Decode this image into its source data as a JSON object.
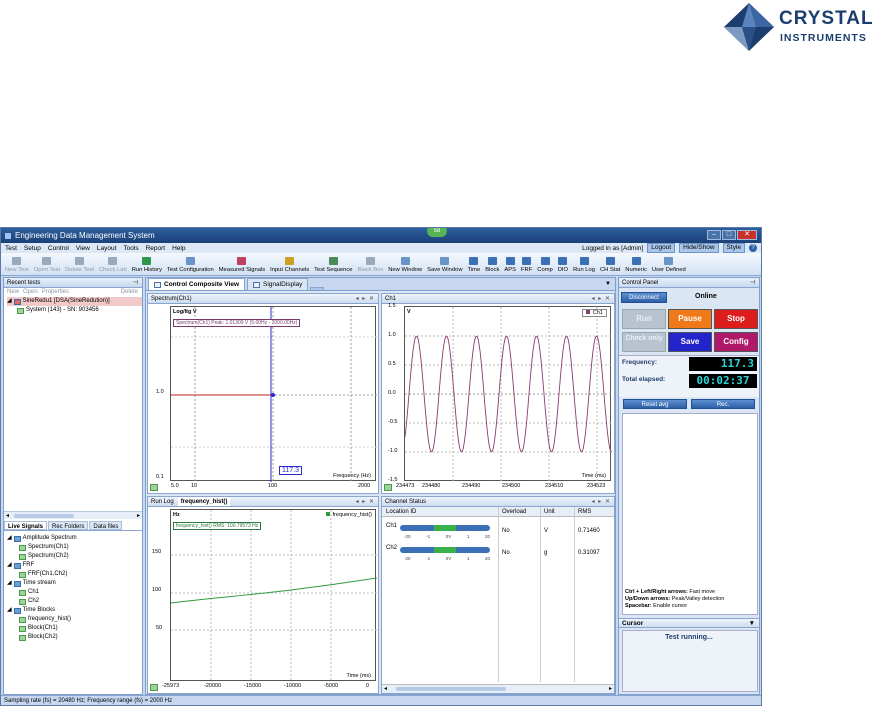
{
  "logo": {
    "line1": "CRYSTAL",
    "line2": "INSTRUMENTS"
  },
  "window": {
    "title": "Engineering Data Management System",
    "badge": "58"
  },
  "menu": {
    "items": [
      "Test",
      "Setup",
      "Control",
      "View",
      "Layout",
      "Tools",
      "Report",
      "Help"
    ],
    "logged_in": "Logged in as [Admin]",
    "logout": "Logout",
    "hide_show": "Hide/Show",
    "style": "Style",
    "help_icon": "?"
  },
  "toolbar": {
    "items": [
      "New Test",
      "Open Test",
      "Delete Test",
      "Check Lab",
      "Run History",
      "Test Configuration",
      "Measured Signals",
      "Input Channels",
      "Test Sequence",
      "Black Box",
      "New Window",
      "Save Window",
      "Time",
      "Block",
      "APS",
      "FRF",
      "Comp",
      "DIO",
      "Run Log",
      "CH Stat",
      "Numeric",
      "User Defined"
    ]
  },
  "recent_tests": {
    "header": "Recent tests",
    "actions": [
      "New",
      "Open",
      "Properties"
    ],
    "delete": "Delete",
    "items": [
      "SineRedu1  [DSA(SineRedution)]",
      "System (143) - SN: 903456"
    ]
  },
  "left_tabs": [
    "Live Signals",
    "Rec Folders",
    "Data files"
  ],
  "signal_tree": [
    {
      "label": "Amplitude Spectrum",
      "level": 0
    },
    {
      "label": "Spectrum(Ch1)",
      "level": 1
    },
    {
      "label": "Spectrum(Ch2)",
      "level": 1
    },
    {
      "label": "FRF",
      "level": 0
    },
    {
      "label": "FRF(Ch1,Ch2)",
      "level": 1
    },
    {
      "label": "Time stream",
      "level": 0
    },
    {
      "label": "Ch1",
      "level": 1
    },
    {
      "label": "Ch2",
      "level": 1
    },
    {
      "label": "Time Blocks",
      "level": 0
    },
    {
      "label": "frequency_hist()",
      "level": 1
    },
    {
      "label": "Block(Ch1)",
      "level": 1
    },
    {
      "label": "Block(Ch2)",
      "level": 1
    }
  ],
  "doc_tabs": [
    "Control Composite View",
    "SignalDisplay"
  ],
  "win_controls": "◂ ▸ ✕",
  "spectrum": {
    "tab": "Spectrum(Ch1)",
    "ylabel": "Log/Itg V",
    "annotation": "Spectrum(Ch1) Peak: 1.01309 V (5.00Hz - 2000.00Hz)",
    "yticks": [
      "1.0",
      "0.1"
    ],
    "xticks": [
      "5.0",
      "10",
      "100",
      "2000"
    ],
    "xlabel": "Frequency (Hz)",
    "cursor_value": "117.3"
  },
  "ch1": {
    "tab": "Ch1",
    "ylabel": "V",
    "legend": "Ch1",
    "yticks": [
      "1.5",
      "1.0",
      "0.5",
      "0.0",
      "-0.5",
      "-1.0",
      "-1.5"
    ],
    "xticks": [
      "234473",
      "234480",
      "234490",
      "234500",
      "234510",
      "234523"
    ],
    "xlabel": "Time (ms)"
  },
  "freq": {
    "tabs": [
      "Run Log",
      "frequency_hist()"
    ],
    "ylabel": "Hz",
    "legend": "frequency_hist()",
    "annotation": "frequency_hist() RMS: 100.79573 Hz",
    "yticks": [
      "150",
      "100",
      "50"
    ],
    "xticks": [
      "-25973",
      "-20000",
      "-15000",
      "-10000",
      "-5000",
      "0"
    ],
    "xlabel": "Time (ms)"
  },
  "channel_status": {
    "tab": "Channel Status",
    "columns": [
      "Location ID",
      "Overload",
      "Unit",
      "RMS"
    ],
    "rows": [
      {
        "id": "Ch1",
        "overload": "No",
        "unit": "V",
        "rms": "0.71460"
      },
      {
        "id": "Ch2",
        "overload": "No",
        "unit": "g",
        "rms": "0.31097"
      }
    ],
    "scale": [
      "-20",
      "-1",
      "0V",
      "1",
      "20"
    ]
  },
  "control_panel": {
    "header": "Control Panel",
    "disconnect": "Disconnect",
    "online": "Online",
    "run": "Run",
    "pause": "Pause",
    "stop": "Stop",
    "check_only": "Check only",
    "save": "Save",
    "config": "Config",
    "frequency_label": "Frequency:",
    "frequency_value": "117.3",
    "elapsed_label": "Total elapsed:",
    "elapsed_value": "00:02:37",
    "reset_avg": "Reset avg",
    "rec": "Rec.",
    "help_lines": [
      {
        "key": "Ctrl + Left/Right arrows:",
        "text": "Fast move"
      },
      {
        "key": "Up/Down arrows:",
        "text": "Peak/Valley detection"
      },
      {
        "key": "Spacebar:",
        "text": "Enable cursor"
      }
    ],
    "cursor_label": "Cursor",
    "status": "Test running..."
  },
  "statusbar": "Sampling rate (fs) = 20480 Hz; Frequency range (fs) = 2000 Hz",
  "colors": {
    "pause": "#f07a1a",
    "stop": "#dd1c1c",
    "save": "#2424cc",
    "config": "#b0186a",
    "signal": "#8b3a72",
    "trend": "#2e9a3e"
  }
}
